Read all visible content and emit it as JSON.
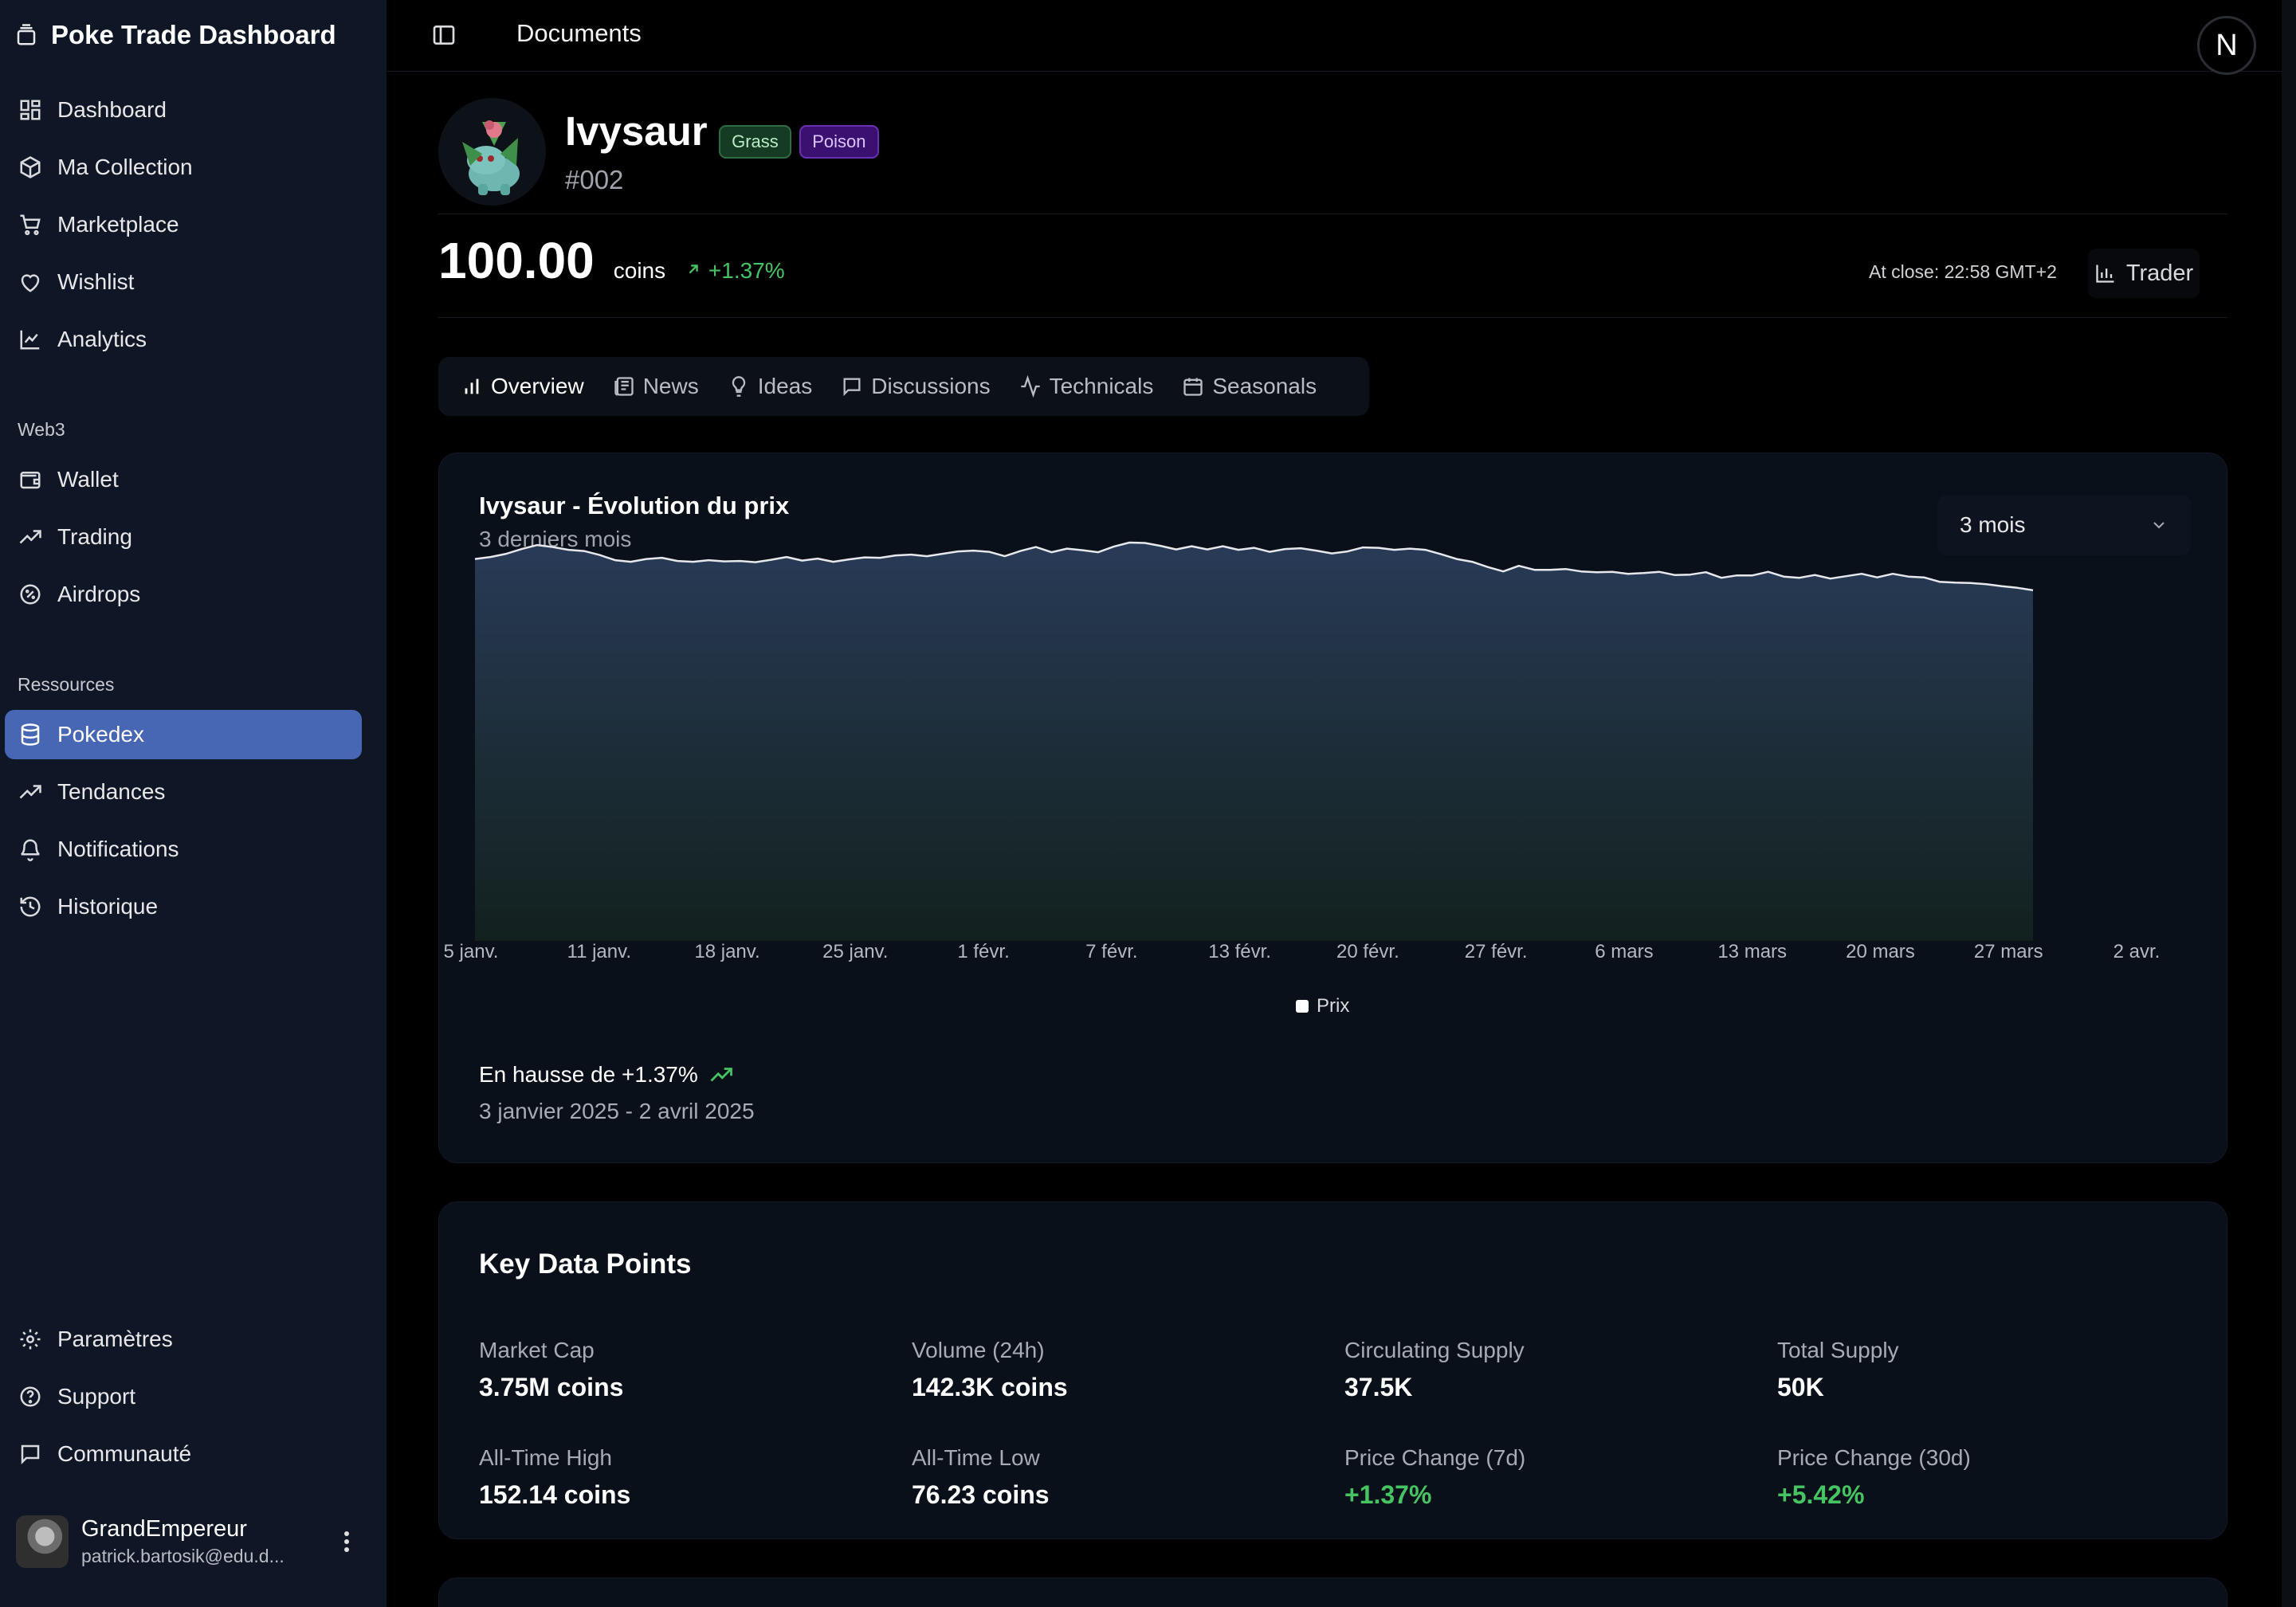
{
  "app": {
    "title": "Poke Trade Dashboard"
  },
  "sidebar": {
    "main_items": [
      {
        "label": "Dashboard",
        "icon": "grid-icon"
      },
      {
        "label": "Ma Collection",
        "icon": "box-icon"
      },
      {
        "label": "Marketplace",
        "icon": "cart-icon"
      },
      {
        "label": "Wishlist",
        "icon": "heart-icon"
      },
      {
        "label": "Analytics",
        "icon": "line-chart-icon"
      }
    ],
    "web3_title": "Web3",
    "web3_items": [
      {
        "label": "Wallet",
        "icon": "wallet-icon"
      },
      {
        "label": "Trading",
        "icon": "trending-up-icon"
      },
      {
        "label": "Airdrops",
        "icon": "badge-percent-icon"
      }
    ],
    "resources_title": "Ressources",
    "resources_items": [
      {
        "label": "Pokedex",
        "icon": "database-icon",
        "active": true
      },
      {
        "label": "Tendances",
        "icon": "trending-up-icon"
      },
      {
        "label": "Notifications",
        "icon": "bell-icon"
      },
      {
        "label": "Historique",
        "icon": "history-icon"
      }
    ],
    "footer_items": [
      {
        "label": "Paramètres",
        "icon": "gear-icon"
      },
      {
        "label": "Support",
        "icon": "help-circle-icon"
      },
      {
        "label": "Communauté",
        "icon": "message-icon"
      }
    ],
    "user": {
      "name": "GrandEmpereur",
      "email": "patrick.bartosik@edu.d..."
    },
    "active_color": "#4766b3"
  },
  "header": {
    "title": "Documents",
    "avatar_letter": "N"
  },
  "pokemon": {
    "name": "Ivysaur",
    "number": "#002",
    "types": [
      {
        "label": "Grass",
        "color": "#163b24"
      },
      {
        "label": "Poison",
        "color": "#3a1170"
      }
    ]
  },
  "price": {
    "value": "100.00",
    "unit": "coins",
    "change": "+1.37%",
    "at_close": "At close: 22:58 GMT+2",
    "trader_label": "Trader",
    "positive_color": "#46c463"
  },
  "tabs": [
    {
      "label": "Overview",
      "icon": "bar-chart-icon",
      "active": true
    },
    {
      "label": "News",
      "icon": "newspaper-icon"
    },
    {
      "label": "Ideas",
      "icon": "lightbulb-icon"
    },
    {
      "label": "Discussions",
      "icon": "message-square-icon"
    },
    {
      "label": "Technicals",
      "icon": "activity-icon"
    },
    {
      "label": "Seasonals",
      "icon": "calendar-icon"
    }
  ],
  "chart_card": {
    "title": "Ivysaur - Évolution du prix",
    "subtitle": "3 derniers mois",
    "range_select": "3 mois",
    "trend_text": "En hausse de +1.37%",
    "date_range": "3 janvier 2025 - 2 avril 2025"
  },
  "chart_data": {
    "type": "area",
    "x_tick_labels": [
      "5 janv.",
      "11 janv.",
      "18 janv.",
      "25 janv.",
      "1 févr.",
      "7 févr.",
      "13 févr.",
      "20 févr.",
      "27 févr.",
      "6 mars",
      "13 mars",
      "20 mars",
      "27 mars",
      "2 avr."
    ],
    "series": [
      {
        "name": "Prix",
        "values": [
          95.5,
          96,
          96.8,
          98,
          99,
          98.5,
          97.8,
          97.5,
          96.5,
          95.2,
          94.8,
          95.5,
          95.8,
          95,
          94.8,
          95.2,
          94.9,
          95,
          94.7,
          95.3,
          96,
          95.1,
          95.6,
          94.8,
          95.4,
          95.9,
          95.8,
          96.4,
          96.6,
          96.2,
          96.8,
          97.4,
          97.6,
          97.3,
          96.2,
          97.5,
          98.5,
          97.2,
          98.1,
          97.7,
          97.2,
          98.6,
          99.6,
          99.5,
          98.8,
          97.9,
          98.7,
          97.9,
          98.7,
          97.8,
          98.3,
          97.3,
          98,
          98.2,
          97.6,
          96.9,
          97.4,
          98.4,
          98.3,
          97.8,
          98.1,
          97.8,
          96.7,
          95.5,
          94.8,
          93.5,
          92.4,
          93.8,
          92.8,
          92.8,
          93,
          92.4,
          92.2,
          92.3,
          91.8,
          92,
          92.3,
          91.5,
          91.6,
          92.2,
          90.8,
          91.4,
          91.4,
          92.3,
          91.1,
          90.8,
          91.5,
          90.6,
          91.2,
          91.8,
          90.9,
          91.8,
          91.1,
          90.9,
          89.8,
          89.6,
          89.5,
          89.2,
          88.7,
          88.3,
          87.7
        ]
      }
    ],
    "y_range": [
      0,
      102
    ],
    "grid": false,
    "legend_position": "bottom-center",
    "line_color": "#e6e8ec"
  },
  "key_data": {
    "title": "Key Data Points",
    "items": [
      {
        "label": "Market Cap",
        "value": "3.75M coins"
      },
      {
        "label": "Volume (24h)",
        "value": "142.3K coins"
      },
      {
        "label": "Circulating Supply",
        "value": "37.5K"
      },
      {
        "label": "Total Supply",
        "value": "50K"
      },
      {
        "label": "All-Time High",
        "value": "152.14 coins"
      },
      {
        "label": "All-Time Low",
        "value": "76.23 coins"
      },
      {
        "label": "Price Change (7d)",
        "value": "+1.37%",
        "positive": true
      },
      {
        "label": "Price Change (30d)",
        "value": "+5.42%",
        "positive": true
      }
    ]
  }
}
